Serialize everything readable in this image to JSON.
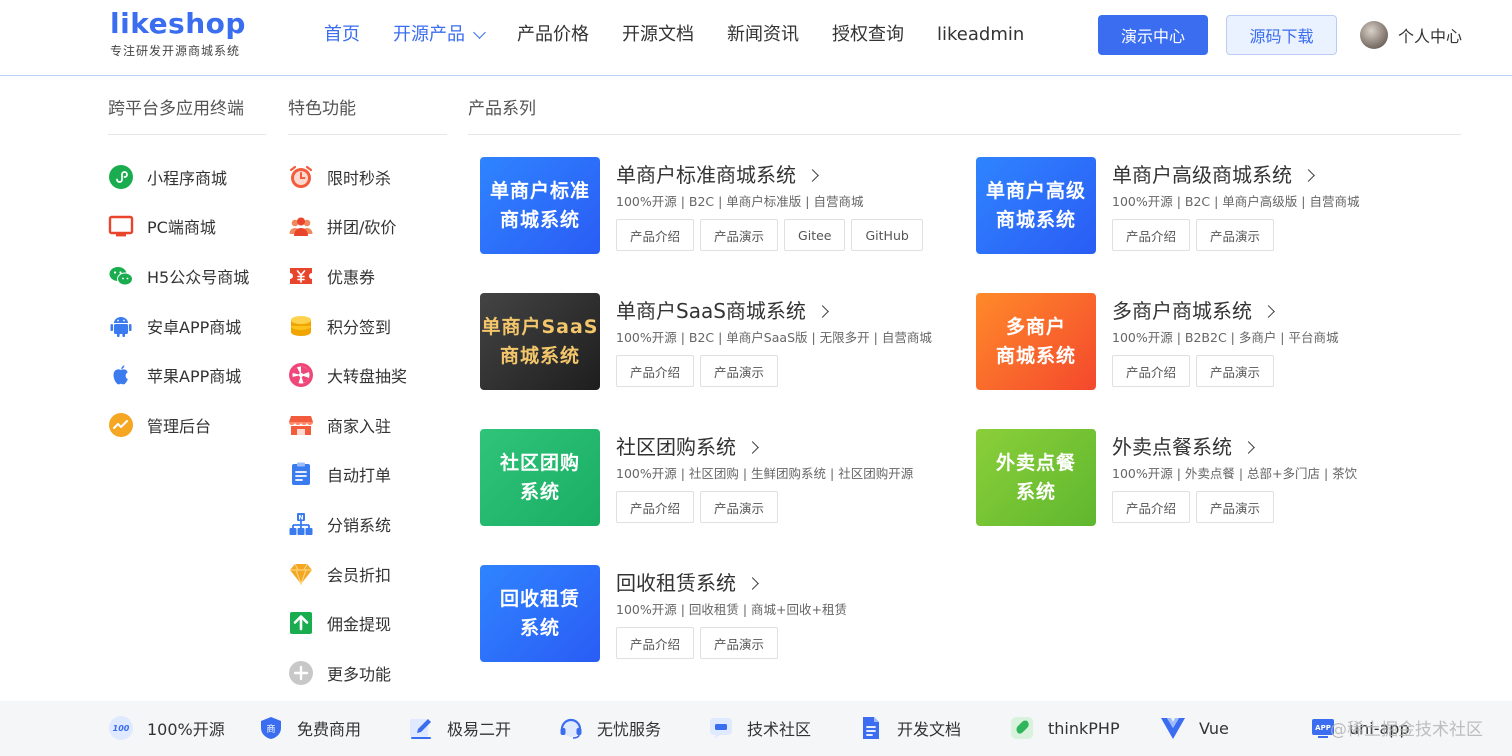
{
  "header": {
    "logo_text": "likeshop",
    "slogan": "专注研发开源商城系统",
    "nav": [
      {
        "label": "首页",
        "active": true
      },
      {
        "label": "开源产品",
        "dropdown": true
      },
      {
        "label": "产品价格"
      },
      {
        "label": "开源文档"
      },
      {
        "label": "新闻资讯"
      },
      {
        "label": "授权查询"
      },
      {
        "label": "likeadmin"
      }
    ],
    "demo_button": "演示中心",
    "download_button": "源码下载",
    "user_label": "个人中心",
    "accent_color": "#3a6df0"
  },
  "platforms": {
    "title": "跨平台多应用终端",
    "items": [
      {
        "label": "小程序商城",
        "icon": "miniprogram-icon"
      },
      {
        "label": "PC端商城",
        "icon": "monitor-icon"
      },
      {
        "label": "H5公众号商城",
        "icon": "wechat-icon"
      },
      {
        "label": "安卓APP商城",
        "icon": "android-icon"
      },
      {
        "label": "苹果APP商城",
        "icon": "apple-icon"
      },
      {
        "label": "管理后台",
        "icon": "dashboard-icon"
      }
    ]
  },
  "features": {
    "title": "特色功能",
    "items": [
      {
        "label": "限时秒杀",
        "icon": "alarm-clock-icon"
      },
      {
        "label": "拼团/砍价",
        "icon": "group-icon"
      },
      {
        "label": "优惠券",
        "icon": "coupon-icon"
      },
      {
        "label": "积分签到",
        "icon": "coins-icon"
      },
      {
        "label": "大转盘抽奖",
        "icon": "wheel-icon"
      },
      {
        "label": "商家入驻",
        "icon": "store-icon"
      },
      {
        "label": "自动打单",
        "icon": "clipboard-icon"
      },
      {
        "label": "分销系统",
        "icon": "network-icon"
      },
      {
        "label": "会员折扣",
        "icon": "diamond-icon"
      },
      {
        "label": "佣金提现",
        "icon": "withdraw-icon"
      },
      {
        "label": "更多功能",
        "icon": "plus-circle-icon"
      }
    ]
  },
  "products": {
    "title": "产品系列",
    "items": [
      {
        "thumb_line1": "单商户标准",
        "thumb_line2": "商城系统",
        "title": "单商户标准商城系统",
        "desc": "100%开源 | B2C | 单商户标准版 | 自营商城",
        "tags": [
          "产品介绍",
          "产品演示",
          "Gitee",
          "GitHub"
        ]
      },
      {
        "thumb_line1": "单商户高级",
        "thumb_line2": "商城系统",
        "title": "单商户高级商城系统",
        "desc": "100%开源 | B2C | 单商户高级版 | 自营商城",
        "tags": [
          "产品介绍",
          "产品演示"
        ]
      },
      {
        "thumb_line1": "单商户SaaS",
        "thumb_line2": "商城系统",
        "title": "单商户SaaS商城系统",
        "desc": "100%开源 | B2C | 单商户SaaS版 | 无限多开 | 自营商城",
        "tags": [
          "产品介绍",
          "产品演示"
        ]
      },
      {
        "thumb_line1": "多商户",
        "thumb_line2": "商城系统",
        "title": "多商户商城系统",
        "desc": "100%开源 | B2B2C | 多商户 | 平台商城",
        "tags": [
          "产品介绍",
          "产品演示"
        ]
      },
      {
        "thumb_line1": "社区团购",
        "thumb_line2": "系统",
        "title": "社区团购系统",
        "desc": "100%开源 | 社区团购 | 生鲜团购系统 | 社区团购开源",
        "tags": [
          "产品介绍",
          "产品演示"
        ]
      },
      {
        "thumb_line1": "外卖点餐",
        "thumb_line2": "系统",
        "title": "外卖点餐系统",
        "desc": "100%开源 | 外卖点餐 | 总部+多门店 | 茶饮",
        "tags": [
          "产品介绍",
          "产品演示"
        ]
      },
      {
        "thumb_line1": "回收租赁",
        "thumb_line2": "系统",
        "title": "回收租赁系统",
        "desc": "100%开源 | 回收租赁 | 商城+回收+租赁",
        "tags": [
          "产品介绍",
          "产品演示"
        ]
      }
    ]
  },
  "footer": {
    "items": [
      {
        "label": "100%开源",
        "icon": "opensource-icon"
      },
      {
        "label": "免费商用",
        "icon": "shield-icon"
      },
      {
        "label": "极易二开",
        "icon": "edit-icon"
      },
      {
        "label": "无忧服务",
        "icon": "headset-icon"
      },
      {
        "label": "技术社区",
        "icon": "chat-icon"
      },
      {
        "label": "开发文档",
        "icon": "document-icon"
      },
      {
        "label": "thinkPHP",
        "icon": "thinkphp-icon"
      },
      {
        "label": "Vue",
        "icon": "vue-icon"
      },
      {
        "label": "uni-app",
        "icon": "uniapp-icon"
      }
    ],
    "watermark": "@稀土掘金技术社区"
  }
}
